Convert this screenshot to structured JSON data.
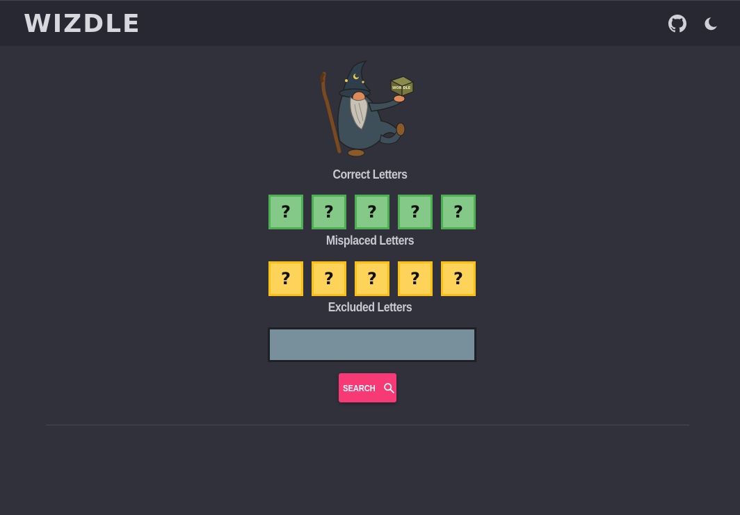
{
  "header": {
    "logo_text": "WIZDLE",
    "github_icon": "github-icon",
    "theme_icon": "moon-icon"
  },
  "illustration": {
    "icon": "wizard-illustration",
    "cube_text": "WOR DLE"
  },
  "correct": {
    "label": "Correct Letters",
    "tiles": [
      "?",
      "?",
      "?",
      "?",
      "?"
    ],
    "color": "#84c987",
    "border_color": "#4caf50"
  },
  "misplaced": {
    "label": "Misplaced Letters",
    "tiles": [
      "?",
      "?",
      "?",
      "?",
      "?"
    ],
    "color": "#fdd35a",
    "border_color": "#fbbf16"
  },
  "excluded": {
    "label": "Excluded Letters",
    "value": "",
    "placeholder": ""
  },
  "search": {
    "label": "SEARCH",
    "icon": "search-icon",
    "color": "#f73a76"
  },
  "theme": {
    "background": "#31313c",
    "topbar": "#282832"
  }
}
